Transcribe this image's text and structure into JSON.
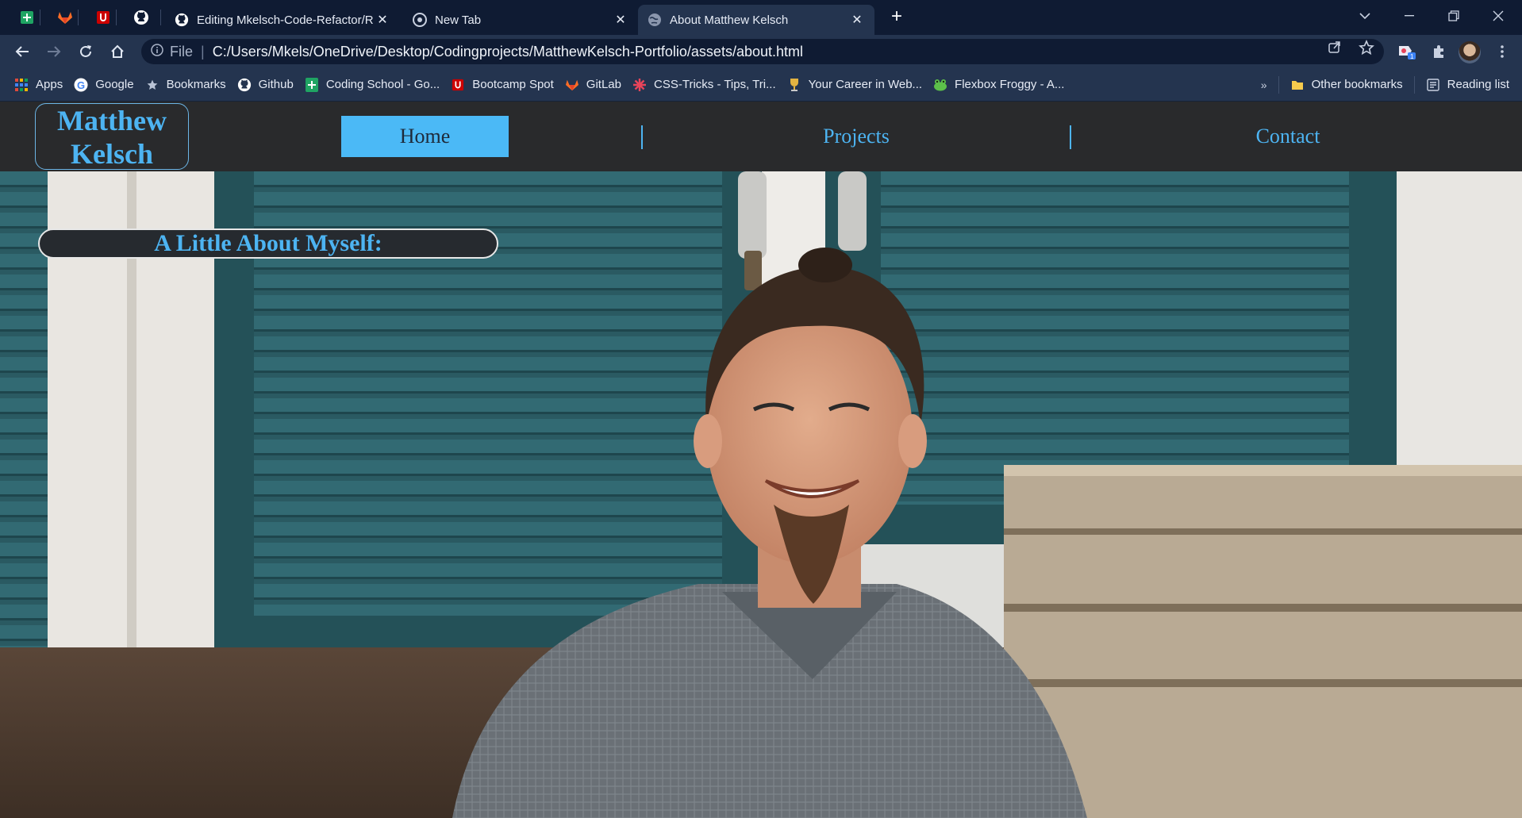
{
  "browser": {
    "pinned_tabs": [
      {
        "icon": "google-sheets-icon"
      },
      {
        "icon": "gitlab-icon"
      },
      {
        "icon": "university-of-utah-icon"
      },
      {
        "icon": "github-icon"
      }
    ],
    "tabs": [
      {
        "title": "Editing Mkelsch-Code-Refactor/R",
        "icon": "github-icon",
        "active": false
      },
      {
        "title": "New Tab",
        "icon": "chrome-icon",
        "active": false
      },
      {
        "title": "About Matthew Kelsch",
        "icon": "globe-icon",
        "active": true
      }
    ],
    "address": {
      "scheme": "File",
      "url": "C:/Users/Mkels/OneDrive/Desktop/Codingprojects/MatthewKelsch-Portfolio/assets/about.html"
    },
    "bookmarks": [
      {
        "label": "Apps",
        "icon": "apps-grid-icon"
      },
      {
        "label": "Google",
        "icon": "google-icon"
      },
      {
        "label": "Bookmarks",
        "icon": "star-icon"
      },
      {
        "label": "Github",
        "icon": "github-icon"
      },
      {
        "label": "Coding School - Go...",
        "icon": "google-sheets-icon"
      },
      {
        "label": "Bootcamp Spot",
        "icon": "university-of-utah-icon"
      },
      {
        "label": "GitLab",
        "icon": "gitlab-icon"
      },
      {
        "label": "CSS-Tricks - Tips, Tri...",
        "icon": "css-tricks-icon"
      },
      {
        "label": "Your Career in Web...",
        "icon": "trophy-icon"
      },
      {
        "label": "Flexbox Froggy - A...",
        "icon": "frog-icon"
      }
    ],
    "bookmarks_overflow": "»",
    "other_bookmarks": "Other bookmarks",
    "reading_list": "Reading list"
  },
  "site": {
    "logo": {
      "line1": "Matthew",
      "line2": "Kelsch"
    },
    "nav": {
      "home": "Home",
      "projects": "Projects",
      "contact": "Contact"
    },
    "about_heading": "A Little About Myself:"
  },
  "colors": {
    "accent": "#4db4f2",
    "header_bg": "#292a2c",
    "browser_frame": "#0f1b33",
    "browser_toolbar": "#24344f"
  }
}
